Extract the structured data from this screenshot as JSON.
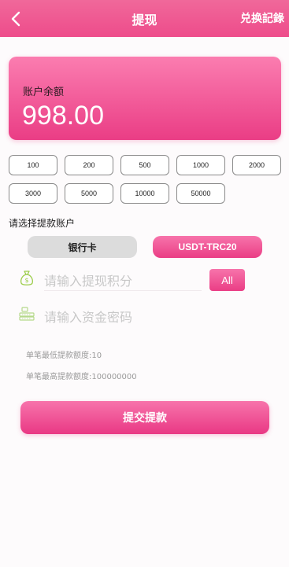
{
  "header": {
    "title": "提现",
    "right_link": "兑换記錄"
  },
  "balance": {
    "label": "账户余额",
    "value": "998.00"
  },
  "amounts": [
    "100",
    "200",
    "500",
    "1000",
    "2000",
    "3000",
    "5000",
    "10000",
    "50000"
  ],
  "account": {
    "label": "请选择提款账户",
    "tabs": [
      "银行卡",
      "USDT-TRC20"
    ],
    "selected": "USDT-TRC20"
  },
  "points_field": {
    "placeholder": "请输入提现积分",
    "all_label": "All"
  },
  "password_field": {
    "placeholder": "请输入资金密码"
  },
  "limits": {
    "min": "单笔最低提款额度:10",
    "max": "单笔最高提款额度:100000000"
  },
  "submit_label": "提交提款",
  "colors": {
    "accent": "#ee4c8b",
    "accent_light": "#f774ab",
    "tab_inactive": "#dcdcdc"
  }
}
